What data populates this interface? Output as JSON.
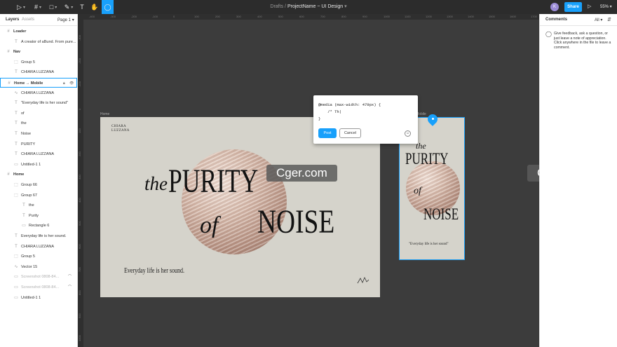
{
  "toolbar": {
    "tools": [
      {
        "name": "move-tool",
        "glyph": "▷",
        "has_menu": true
      },
      {
        "name": "frame-tool",
        "glyph": "#",
        "has_menu": true
      },
      {
        "name": "shape-tool",
        "glyph": "□",
        "has_menu": true
      },
      {
        "name": "pen-tool",
        "glyph": "✎",
        "has_menu": true
      },
      {
        "name": "text-tool",
        "glyph": "T",
        "has_menu": false
      },
      {
        "name": "hand-tool",
        "glyph": "✋",
        "has_menu": false
      },
      {
        "name": "comment-tool",
        "glyph": "◯",
        "has_menu": false,
        "active": true
      }
    ],
    "breadcrumb_folder": "Drafts",
    "breadcrumb_sep": "/",
    "project_name": "ProjectName ~ UI Design",
    "avatar_initial": "K",
    "share_label": "Share",
    "play_glyph": "▷",
    "zoom": "55%"
  },
  "left_panel": {
    "tab_layers": "Layers",
    "tab_assets": "Assets",
    "page": "Page 1",
    "layers": [
      {
        "label": "Loader",
        "type": "frame",
        "level": 0,
        "bold": true
      },
      {
        "label": "A creator of aBund. From pure...",
        "type": "text",
        "level": 1
      },
      {
        "label": "Nav",
        "type": "frame",
        "level": 0,
        "bold": true
      },
      {
        "label": "Group 5",
        "type": "group",
        "level": 1
      },
      {
        "label": "CHIARA LUZZANA",
        "type": "text",
        "level": 1
      },
      {
        "label": "Home → Mobile",
        "type": "frame",
        "level": 0,
        "bold": true,
        "selected": true
      },
      {
        "label": "CHIARA LUZZANA",
        "type": "vector",
        "level": 1
      },
      {
        "label": "\"Everyday life is her sound\"",
        "type": "text",
        "level": 1
      },
      {
        "label": "of",
        "type": "text",
        "level": 1
      },
      {
        "label": "the",
        "type": "text",
        "level": 1
      },
      {
        "label": "Noise",
        "type": "text",
        "level": 1
      },
      {
        "label": "PURITY",
        "type": "text",
        "level": 1
      },
      {
        "label": "CHIARA LUZZANA",
        "type": "text",
        "level": 1
      },
      {
        "label": "Untitled-1 1",
        "type": "image",
        "level": 1
      },
      {
        "label": "Home",
        "type": "frame",
        "level": 0,
        "bold": true
      },
      {
        "label": "Group 66",
        "type": "group",
        "level": 1
      },
      {
        "label": "Group 67",
        "type": "group",
        "level": 1
      },
      {
        "label": "the",
        "type": "text",
        "level": 2
      },
      {
        "label": "Purity",
        "type": "text",
        "level": 2
      },
      {
        "label": "Rectangle 6",
        "type": "rect",
        "level": 2
      },
      {
        "label": "Everyday life is her sound.",
        "type": "text",
        "level": 1
      },
      {
        "label": "CHIARA LUZZANA",
        "type": "text",
        "level": 1
      },
      {
        "label": "Group 5",
        "type": "group",
        "level": 1
      },
      {
        "label": "Vector 15",
        "type": "vector",
        "level": 1
      },
      {
        "label": "Screenshot 0808-84...",
        "type": "image",
        "level": 1,
        "dim": true
      },
      {
        "label": "Screenshot 0808-84...",
        "type": "image",
        "level": 1,
        "dim": true
      },
      {
        "label": "Untitled-1 1",
        "type": "image",
        "level": 1
      }
    ]
  },
  "canvas": {
    "home_label": "Home",
    "mobile_label": "Mobile",
    "brand_line1": "CHIARA",
    "brand_line2": "LUZZANA",
    "headline_the": "the",
    "headline_purity": "PURITY",
    "headline_of": "of",
    "headline_noise": "NOISE",
    "tagline": "Everyday life is her sound.",
    "mobile_tagline": "\"Everyday life is her sound\"",
    "ruler_top": [
      "-400",
      "-300",
      "-200",
      "-100",
      "0",
      "100",
      "200",
      "300",
      "400",
      "500",
      "600",
      "700",
      "800",
      "900",
      "1000",
      "1100",
      "1200",
      "1300",
      "1400",
      "1500",
      "1600",
      "1700"
    ],
    "ruler_left": [
      "-300",
      "-200",
      "-100",
      "0",
      "100",
      "200",
      "300",
      "400",
      "500",
      "600",
      "700",
      "800",
      "900",
      "1000"
    ]
  },
  "comment_popup": {
    "code_text": "@media (max-width: 479px) {\n    /* Th|\n}",
    "post_label": "Post",
    "cancel_label": "Cancel",
    "emoji_glyph": "☺"
  },
  "watermark": {
    "text": "Cger.com"
  },
  "right_panel": {
    "title": "Comments",
    "filter": "All",
    "sort_glyph": "⇵",
    "icon": "◯",
    "hint": "Give feedback, ask a question, or just leave a note of appreciation. Click anywhere in the file to leave a comment."
  }
}
